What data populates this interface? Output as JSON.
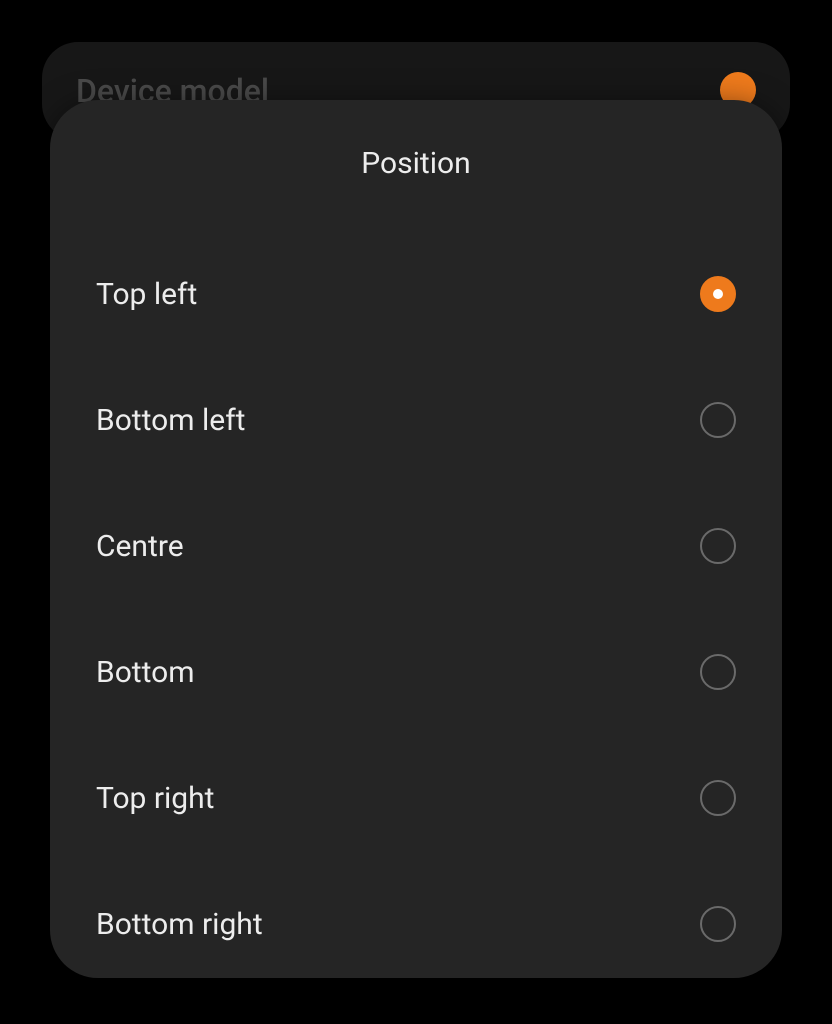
{
  "background": {
    "title": "Device model"
  },
  "modal": {
    "title": "Position",
    "options": [
      {
        "label": "Top left",
        "selected": true
      },
      {
        "label": "Bottom left",
        "selected": false
      },
      {
        "label": "Centre",
        "selected": false
      },
      {
        "label": "Bottom",
        "selected": false
      },
      {
        "label": "Top right",
        "selected": false
      },
      {
        "label": "Bottom right",
        "selected": false
      }
    ]
  },
  "colors": {
    "accent": "#ee7a1c"
  }
}
